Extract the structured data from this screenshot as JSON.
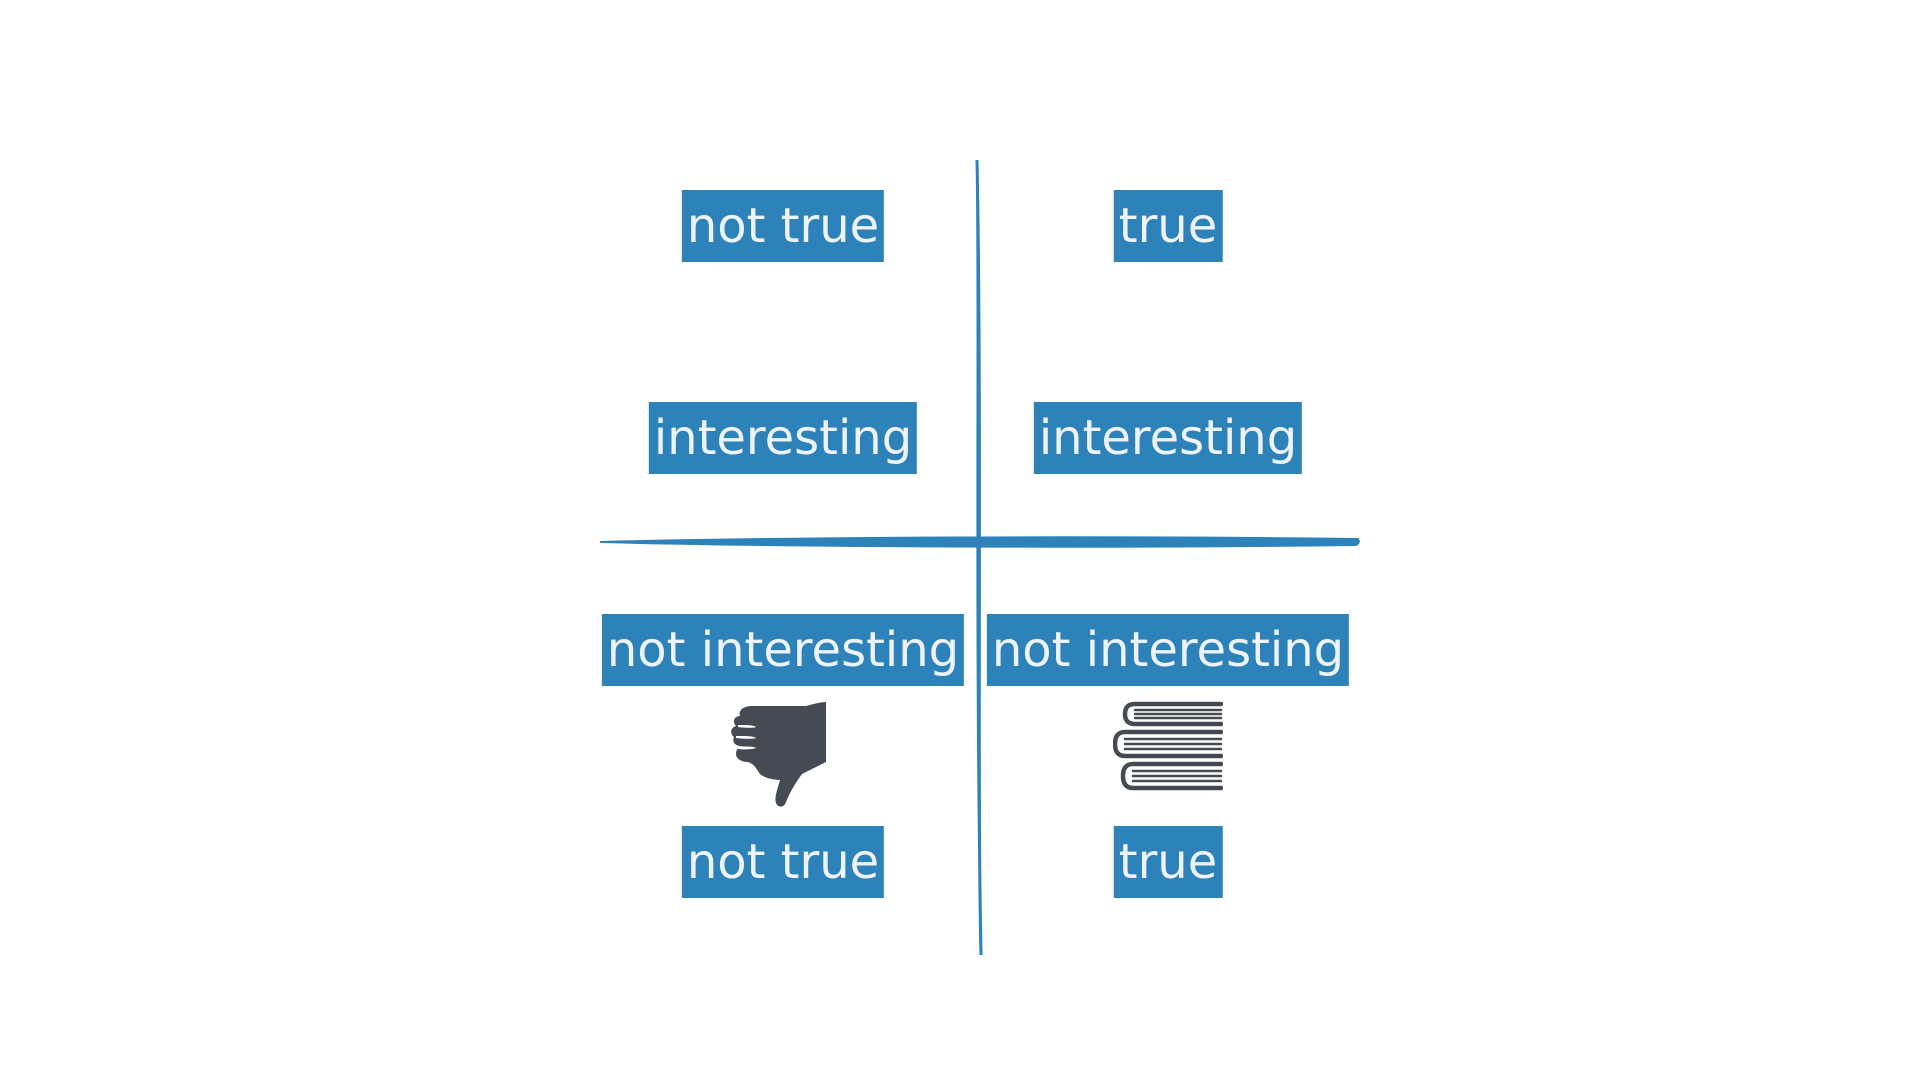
{
  "colors": {
    "accent": "#2d82ba",
    "label_text": "#eef3f8",
    "icon": "#464a52",
    "background": "#ffffff"
  },
  "quadrants": {
    "top_left": {
      "truth": "not true",
      "interest": "interesting"
    },
    "top_right": {
      "truth": "true",
      "interest": "interesting"
    },
    "bottom_left": {
      "interest": "not interesting",
      "truth": "not true",
      "icon": "thumbs-down-icon"
    },
    "bottom_right": {
      "interest": "not interesting",
      "truth": "true",
      "icon": "book-stack-icon"
    }
  }
}
